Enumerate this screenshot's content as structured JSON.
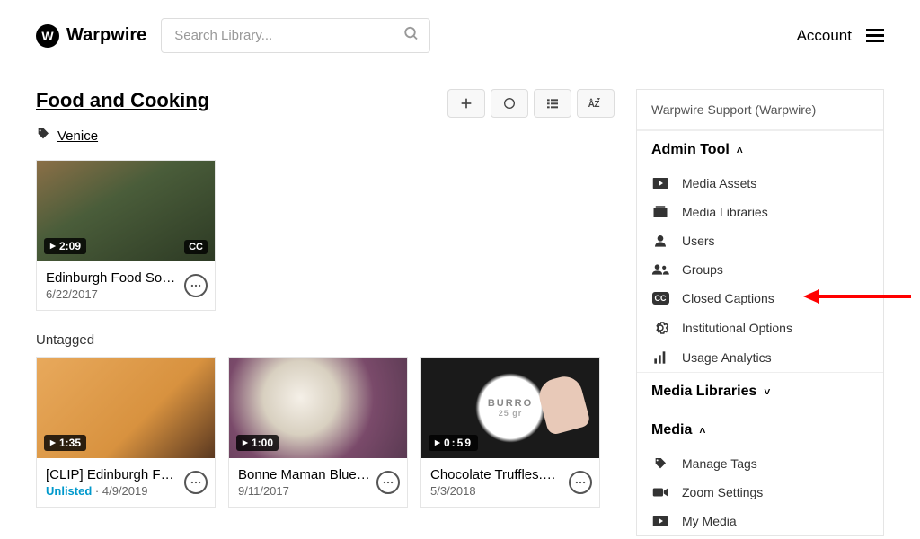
{
  "brand": "Warpwire",
  "search": {
    "placeholder": "Search Library..."
  },
  "account": {
    "label": "Account"
  },
  "page": {
    "title": "Food and Cooking",
    "tag": "Venice",
    "untagged_label": "Untagged"
  },
  "tagged_media": [
    {
      "thumb_class": "thumb-1",
      "duration": "2:09",
      "cc": "CC",
      "title": "Edinburgh Food Soci...",
      "date": "6/22/2017",
      "unlisted": false
    }
  ],
  "untagged_media": [
    {
      "thumb_class": "thumb-2",
      "duration": "1:35",
      "title": "[CLIP] Edinburgh Fo...",
      "unlisted": true,
      "unlisted_label": "Unlisted",
      "date": "4/9/2019"
    },
    {
      "thumb_class": "thumb-3",
      "duration": "1:00",
      "title": "Bonne Maman Blueb...",
      "date": "9/11/2017",
      "unlisted": false
    },
    {
      "thumb_class": "thumb-4",
      "duration": "0:59",
      "title": "Chocolate Truffles.mp4",
      "date": "5/3/2018",
      "unlisted": false,
      "overlay_text": "BURRO",
      "overlay_sub": "25 gr"
    }
  ],
  "sidebar": {
    "support": "Warpwire Support (Warpwire)",
    "sections": [
      {
        "title": "Admin Tool",
        "open": true,
        "items": [
          {
            "icon": "video-play",
            "label": "Media Assets",
            "name": "media-assets"
          },
          {
            "icon": "library",
            "label": "Media Libraries",
            "name": "media-libraries-admin"
          },
          {
            "icon": "user",
            "label": "Users",
            "name": "users"
          },
          {
            "icon": "groups",
            "label": "Groups",
            "name": "groups"
          },
          {
            "icon": "cc",
            "label": "Closed Captions",
            "name": "closed-captions"
          },
          {
            "icon": "gear",
            "label": "Institutional Options",
            "name": "institutional-options"
          },
          {
            "icon": "chart",
            "label": "Usage Analytics",
            "name": "usage-analytics"
          }
        ]
      },
      {
        "title": "Media Libraries",
        "open": false,
        "items": []
      },
      {
        "title": "Media",
        "open": true,
        "items": [
          {
            "icon": "tag",
            "label": "Manage Tags",
            "name": "manage-tags"
          },
          {
            "icon": "camera",
            "label": "Zoom Settings",
            "name": "zoom-settings"
          },
          {
            "icon": "video-play",
            "label": "My Media",
            "name": "my-media"
          }
        ]
      }
    ]
  }
}
